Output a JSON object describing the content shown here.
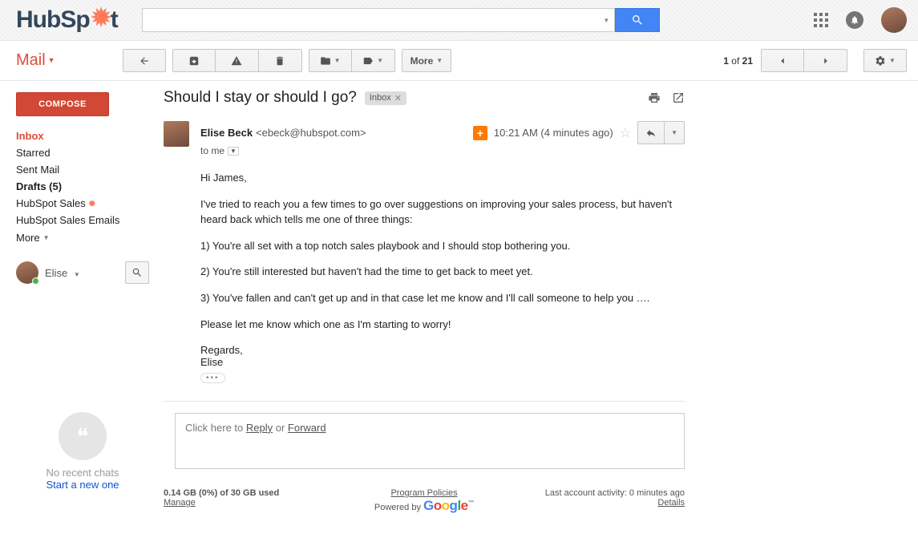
{
  "logo": {
    "part1": "HubSp",
    "part2": "t"
  },
  "header": {
    "search_placeholder": ""
  },
  "mailLabel": "Mail",
  "toolbar": {
    "more": "More",
    "page_current": "1",
    "page_of": "of",
    "page_total": "21"
  },
  "sidebar": {
    "compose": "COMPOSE",
    "items": [
      {
        "label": "Inbox",
        "active": true
      },
      {
        "label": "Starred"
      },
      {
        "label": "Sent Mail"
      },
      {
        "label": "Drafts (5)",
        "bold": true
      },
      {
        "label": "HubSpot Sales",
        "sprocket": true
      },
      {
        "label": "HubSpot Sales Emails"
      }
    ],
    "more": "More",
    "chat_name": "Elise"
  },
  "hangouts": {
    "line1": "No recent chats",
    "line2": "Start a new one"
  },
  "subject": "Should I stay or should I go?",
  "inbox_chip": "Inbox",
  "message": {
    "from_name": "Elise Beck",
    "from_email": "<ebeck@hubspot.com>",
    "to_text": "to me",
    "timestamp": "10:21 AM (4 minutes ago)",
    "paragraphs": [
      "Hi James,",
      "I've tried to reach you a few times to go over suggestions on improving your sales process, but haven't heard back which tells me one of three things:",
      "1) You're all set with a top notch sales playbook and I should stop bothering you.",
      "2) You're still interested but haven't had the time to get back to meet yet.",
      "3) You've fallen and can't get up and in that case let me know and I'll call someone to help you ….",
      "Please let me know which one as I'm starting to worry!"
    ],
    "signoff": "Regards,",
    "sender": "Elise"
  },
  "reply": {
    "pre": "Click here to ",
    "reply": "Reply",
    "or": " or ",
    "forward": "Forward"
  },
  "footer": {
    "storage": "0.14 GB (0%) of 30 GB used",
    "manage": "Manage",
    "policies": "Program Policies",
    "powered": "Powered by ",
    "activity": "Last account activity: 0 minutes ago",
    "details": "Details"
  }
}
